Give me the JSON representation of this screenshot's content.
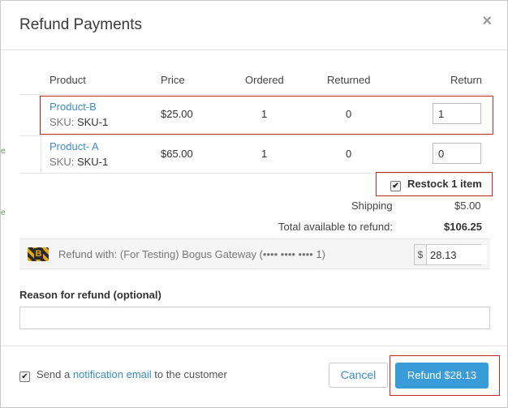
{
  "dialog": {
    "title": "Refund Payments",
    "close_glyph": "×"
  },
  "table": {
    "headers": {
      "product": "Product",
      "price": "Price",
      "ordered": "Ordered",
      "returned": "Returned",
      "return": "Return"
    },
    "rows": [
      {
        "product": "Product-B",
        "sku_label": "SKU:",
        "sku": "SKU-1",
        "price": "$25.00",
        "ordered": "1",
        "returned": "0",
        "return_qty": "1"
      },
      {
        "product": "Product- A",
        "sku_label": "SKU:",
        "sku": "SKU-1",
        "price": "$65.00",
        "ordered": "1",
        "returned": "0",
        "return_qty": "0"
      }
    ]
  },
  "restock": {
    "label": "Restock 1 item",
    "checked": true
  },
  "summary": {
    "shipping_label": "Shipping",
    "shipping_value": "$5.00",
    "total_label": "Total available to refund:",
    "total_value": "$106.25"
  },
  "gateway": {
    "icon": "bogus-gateway-icon",
    "icon_letter": "B",
    "text": "Refund with: (For Testing) Bogus Gateway (•••• •••• •••• 1)",
    "currency": "$",
    "amount": "28.13"
  },
  "reason": {
    "label": "Reason for refund (optional)",
    "value": "",
    "placeholder": ""
  },
  "notification": {
    "checked": true,
    "prefix": "Send a ",
    "link": "notification email",
    "suffix": " to the customer"
  },
  "buttons": {
    "cancel": "Cancel",
    "refund": "Refund $28.13"
  },
  "colors": {
    "accent": "#3a9bd9",
    "link": "#3a8fc8",
    "highlight_border": "#c62828"
  }
}
